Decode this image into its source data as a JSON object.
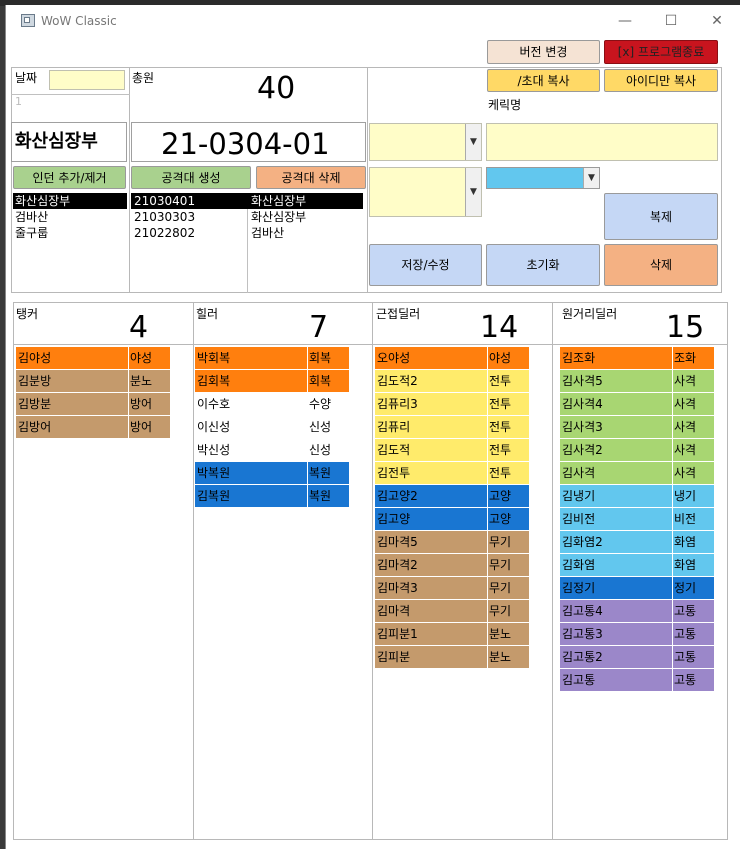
{
  "window": {
    "title": "WoW Classic"
  },
  "titlebar": {
    "minimize": "—",
    "maximize": "☐",
    "close": "✕"
  },
  "header": {
    "version_label": "버전 변경",
    "exit_label": "[x] 프로그램종료"
  },
  "date": {
    "label": "날짜",
    "value": "",
    "sub": "1"
  },
  "total": {
    "label": "총원",
    "value": "40"
  },
  "guild": {
    "name": "화산심장부"
  },
  "raid_id": "21-0304-01",
  "buttons": {
    "dungeon_add": "인던 추가/제거",
    "raid_create": "공격대 생성",
    "raid_delete": "공격대 삭제",
    "invite_copy": "/초대 복사",
    "id_copy": "아이디만 복사",
    "copy": "복제",
    "save": "저장/수정",
    "reset": "초기화",
    "delete": "삭제"
  },
  "char_label": "케릭명",
  "dungeons": [
    "화산심장부",
    "검바산",
    "줄구룹"
  ],
  "raids": [
    {
      "id": "21030401",
      "dungeon": "화산심장부"
    },
    {
      "id": "21030303",
      "dungeon": "화산심장부"
    },
    {
      "id": "21022802",
      "dungeon": "검바산"
    }
  ],
  "colors": {
    "orange": "#ff7f0e",
    "tan": "#c49a6c",
    "yellow": "#ffeb6b",
    "blue": "#1976d2",
    "green": "#a8d672",
    "cyan": "#62c7ee",
    "purple": "#9b87c9",
    "white": "#ffffff",
    "btn_peach": "#f5e3d4",
    "btn_red": "#c8141e",
    "btn_yellow": "#ffd966",
    "btn_green": "#a9d18e",
    "btn_salmon": "#f4b183",
    "btn_blue": "#c5d7f5"
  },
  "columns": [
    {
      "name": "탱커",
      "count": "4",
      "members": [
        {
          "name": "김야성",
          "cls": "야성",
          "color": "orange"
        },
        {
          "name": "김분방",
          "cls": "분노",
          "color": "tan"
        },
        {
          "name": "김방분",
          "cls": "방어",
          "color": "tan"
        },
        {
          "name": "김방어",
          "cls": "방어",
          "color": "tan"
        }
      ]
    },
    {
      "name": "힐러",
      "count": "7",
      "members": [
        {
          "name": "박회복",
          "cls": "회복",
          "color": "orange"
        },
        {
          "name": "김회복",
          "cls": "회복",
          "color": "orange"
        },
        {
          "name": "이수호",
          "cls": "수양",
          "color": "white"
        },
        {
          "name": "이신성",
          "cls": "신성",
          "color": "white"
        },
        {
          "name": "박신성",
          "cls": "신성",
          "color": "white"
        },
        {
          "name": "박복원",
          "cls": "복원",
          "color": "blue"
        },
        {
          "name": "김복원",
          "cls": "복원",
          "color": "blue"
        }
      ]
    },
    {
      "name": "근접딜러",
      "count": "14",
      "members": [
        {
          "name": "오야성",
          "cls": "야성",
          "color": "orange"
        },
        {
          "name": "김도적2",
          "cls": "전투",
          "color": "yellow"
        },
        {
          "name": "김퓨리3",
          "cls": "전투",
          "color": "yellow"
        },
        {
          "name": "김퓨리",
          "cls": "전투",
          "color": "yellow"
        },
        {
          "name": "김도적",
          "cls": "전투",
          "color": "yellow"
        },
        {
          "name": "김전투",
          "cls": "전투",
          "color": "yellow"
        },
        {
          "name": "김고양2",
          "cls": "고양",
          "color": "blue"
        },
        {
          "name": "김고양",
          "cls": "고양",
          "color": "blue"
        },
        {
          "name": "김마격5",
          "cls": "무기",
          "color": "tan"
        },
        {
          "name": "김마격2",
          "cls": "무기",
          "color": "tan"
        },
        {
          "name": "김마격3",
          "cls": "무기",
          "color": "tan"
        },
        {
          "name": "김마격",
          "cls": "무기",
          "color": "tan"
        },
        {
          "name": "김피분1",
          "cls": "분노",
          "color": "tan"
        },
        {
          "name": "김피분",
          "cls": "분노",
          "color": "tan"
        }
      ]
    },
    {
      "name": "원거리딜러",
      "count": "15",
      "members": [
        {
          "name": "김조화",
          "cls": "조화",
          "color": "orange"
        },
        {
          "name": "김사격5",
          "cls": "사격",
          "color": "green"
        },
        {
          "name": "김사격4",
          "cls": "사격",
          "color": "green"
        },
        {
          "name": "김사격3",
          "cls": "사격",
          "color": "green"
        },
        {
          "name": "김사격2",
          "cls": "사격",
          "color": "green"
        },
        {
          "name": "김사격",
          "cls": "사격",
          "color": "green"
        },
        {
          "name": "김냉기",
          "cls": "냉기",
          "color": "cyan"
        },
        {
          "name": "김비전",
          "cls": "비전",
          "color": "cyan"
        },
        {
          "name": "김화염2",
          "cls": "화염",
          "color": "cyan"
        },
        {
          "name": "김화염",
          "cls": "화염",
          "color": "cyan"
        },
        {
          "name": "김정기",
          "cls": "정기",
          "color": "blue"
        },
        {
          "name": "김고통4",
          "cls": "고통",
          "color": "purple"
        },
        {
          "name": "김고통3",
          "cls": "고통",
          "color": "purple"
        },
        {
          "name": "김고통2",
          "cls": "고통",
          "color": "purple"
        },
        {
          "name": "김고통",
          "cls": "고통",
          "color": "purple"
        }
      ]
    }
  ]
}
